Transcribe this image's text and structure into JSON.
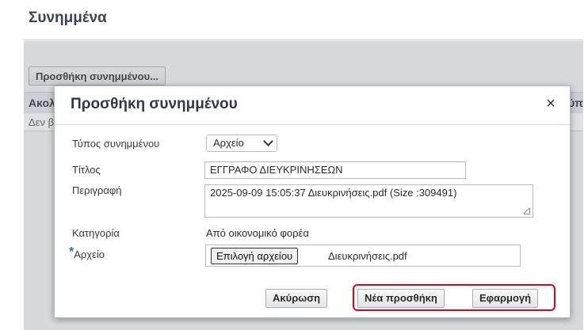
{
  "section": {
    "title": "Συνημμένα",
    "add_button": "Προσθήκη συνημμένου...",
    "table_header_left": "Ακολ",
    "table_header_right": "ύπ",
    "table_empty": "Δεν β"
  },
  "modal": {
    "title": "Προσθήκη συνημμένου",
    "close_symbol": "×",
    "fields": {
      "type_label": "Τύπος συνημμένου",
      "type_value": "Αρχείο",
      "title_label": "Τίτλος",
      "title_value": "ΕΓΓΡΑΦΟ ΔΙΕΥΚΡΙΝΗΣΕΩΝ",
      "description_label": "Περιγραφή",
      "description_value": "2025-09-09 15:05:37 Διευκρινήσεις.pdf (Size :309491)",
      "category_label": "Κατηγορία",
      "category_value": "Από οικονομικό φορέα",
      "file_required_mark": "*",
      "file_label": "Αρχείο",
      "file_button": "Επιλογή αρχείου",
      "file_name": "Διευκρινήσεις.pdf"
    },
    "buttons": {
      "cancel": "Ακύρωση",
      "new_add": "Νέα προσθήκη",
      "apply": "Εφαρμογή"
    }
  },
  "colors": {
    "highlight": "#e5001a",
    "required_mark": "#2a6cc7"
  }
}
